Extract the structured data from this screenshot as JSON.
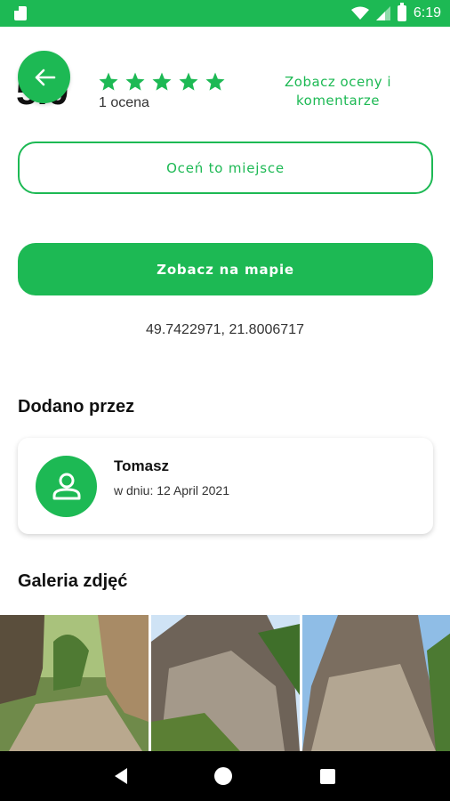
{
  "status_bar": {
    "time": "6:19",
    "icons": [
      "sd-card-icon",
      "wifi-icon",
      "cell-signal-icon",
      "battery-icon"
    ]
  },
  "header": {
    "rating_value": "5.0",
    "stars_filled": 5,
    "stars_total": 5,
    "rating_count": "1 ocena",
    "see_reviews_line1": "Zobacz oceny i",
    "see_reviews_line2": "komentarze"
  },
  "actions": {
    "rate_label": "Oceń to miejsce",
    "map_label": "Zobacz na mapie"
  },
  "location": {
    "coords": "49.7422971, 21.8006717"
  },
  "added_by": {
    "section_title": "Dodano przez",
    "name": "Tomasz",
    "date": "w dniu: 12 April 2021"
  },
  "gallery": {
    "section_title": "Galeria zdjęć",
    "photo_count_visible": 3
  },
  "colors": {
    "accent": "#1db954",
    "text": "#111111",
    "nav_bar": "#000000"
  }
}
